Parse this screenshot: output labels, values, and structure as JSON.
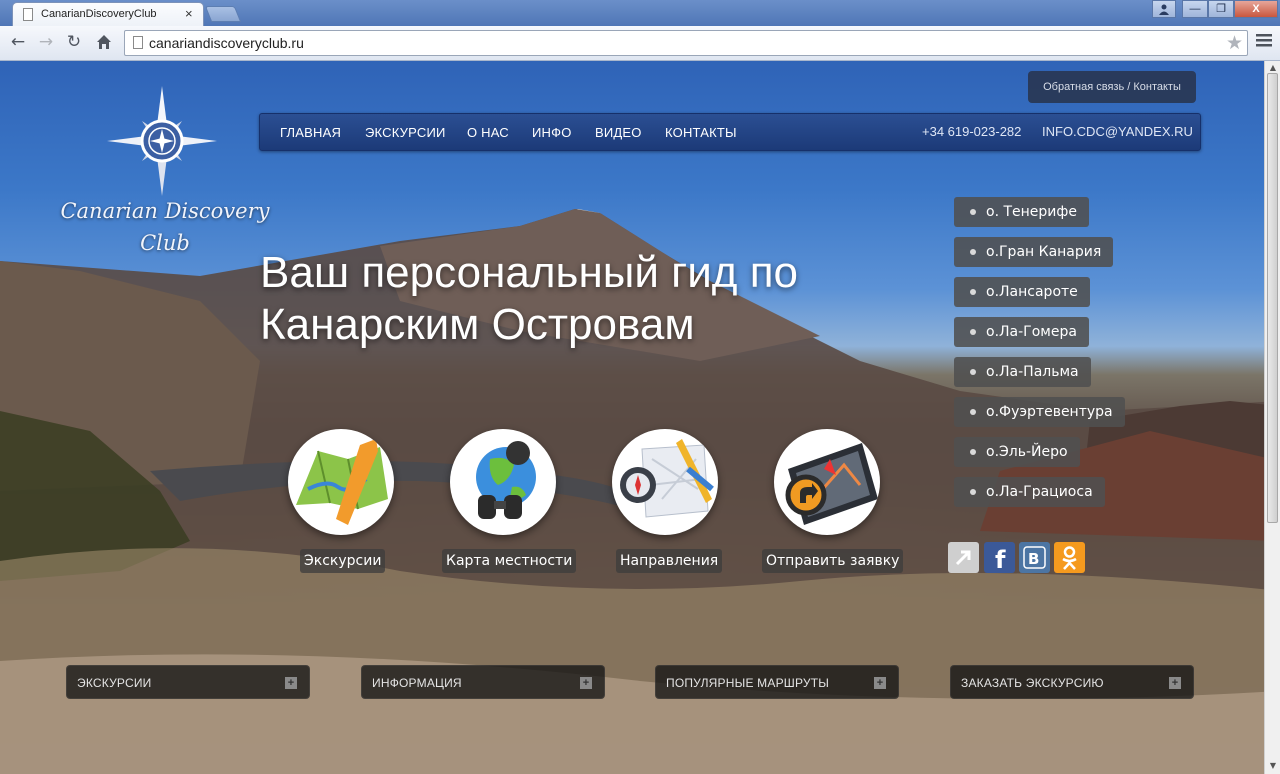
{
  "browser": {
    "tab_title": "CanarianDiscoveryClub",
    "tab_close": "×",
    "url": "canariandiscoveryclub.ru",
    "window_buttons": [
      "—",
      "❐",
      "X"
    ]
  },
  "logo": {
    "line1": "Canarian Discovery",
    "line2": "Club"
  },
  "feedback": {
    "left": "Обратная связь",
    "sep": "/",
    "right": "Контакты"
  },
  "nav": {
    "items": [
      "ГЛАВНАЯ",
      "ЭКСКУРСИИ",
      "О НАС",
      "ИНФО",
      "ВИДЕО",
      "КОНТАКТЫ"
    ],
    "phone": "+34 619-023-282",
    "email": "INFO.CDC@YANDEX.RU"
  },
  "headline": {
    "line1": "Ваш персональный гид по",
    "line2": "Канарским Островам"
  },
  "islands": [
    "о. Тенерифе",
    "о.Гран Канария",
    "о.Лансароте",
    "о.Ла-Гомера",
    "о.Ла-Пальма",
    "о.Фуэртевентура",
    "о.Эль-Йеро",
    "о.Ла-Грациоса"
  ],
  "features": [
    {
      "label": "Экскурсии",
      "icon": "map-icon"
    },
    {
      "label": "Карта местности",
      "icon": "globe-binoculars-icon"
    },
    {
      "label": "Направления",
      "icon": "compass-icon"
    },
    {
      "label": "Отправить заявку",
      "icon": "gps-icon"
    }
  ],
  "social": [
    {
      "name": "share-icon",
      "color": "#c8c8c8",
      "glyph": "↗"
    },
    {
      "name": "facebook-icon",
      "color": "#3b5998",
      "glyph": "f"
    },
    {
      "name": "vkontakte-icon",
      "color": "#4c75a3",
      "glyph": "В"
    },
    {
      "name": "odnoklassniki-icon",
      "color": "#f59a1e",
      "glyph": "ок"
    }
  ],
  "bottom_bars": [
    "ЭКСКУРСИИ",
    "ИНФОРМАЦИЯ",
    "ПОПУЛЯРНЫЕ МАРШРУТЫ",
    "ЗАКАЗАТЬ ЭКСКУРСИЮ"
  ],
  "plus": "+",
  "colors": {
    "nav_bg": "#1f3f80",
    "island_bg": "#505050",
    "bar_bg": "#141414"
  }
}
